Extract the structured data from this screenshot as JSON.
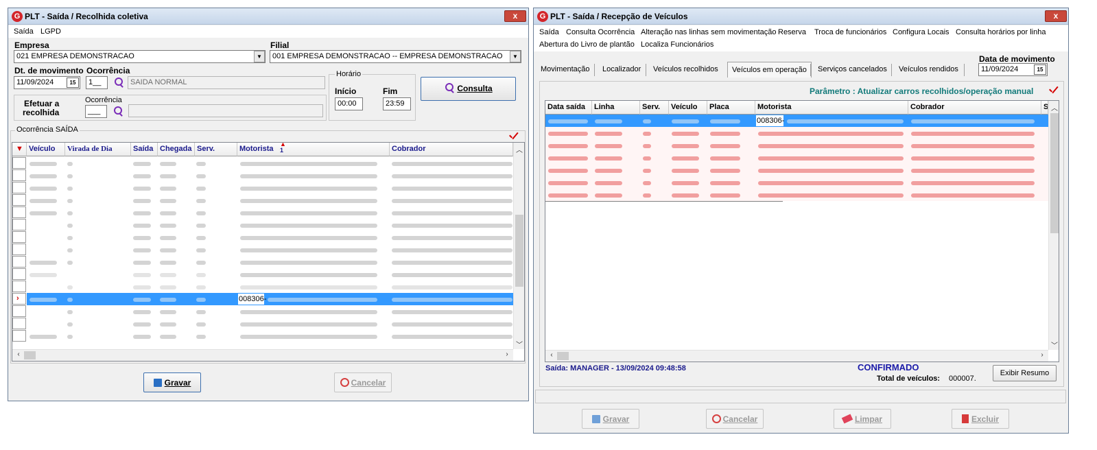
{
  "left_window": {
    "title": "PLT - Saída / Recolhida coletiva",
    "close_label": "x",
    "menu": [
      "Saída",
      "LGPD"
    ],
    "empresa_label": "Empresa",
    "empresa_value": "021 EMPRESA DEMONSTRACAO",
    "filial_label": "Filial",
    "filial_value": "001 EMPRESA DEMONSTRACAO -- EMPRESA DEMONSTRACAO",
    "dt_movimento_label": "Dt. de movimento",
    "dt_movimento_value": "11/09/2024",
    "calendar_label": "15",
    "ocorrencia_label": "Ocorrência",
    "ocorrencia_code": "1__",
    "ocorrencia_desc": "SAIDA NORMAL",
    "efetuar_label_1": "Efetuar a",
    "efetuar_label_2": "recolhida",
    "ocorrencia2_label": "Ocorrência",
    "ocorrencia2_code": "___",
    "horario_label": "Horário",
    "inicio_label": "Início",
    "inicio_value": "00:00",
    "fim_label": "Fim",
    "fim_value": "23:59",
    "consulta_button": "Consulta",
    "group_label": "Ocorrência SAÍDA",
    "columns": [
      "Veículo",
      "Virada de Dia",
      "Saída",
      "Chegada",
      "Serv.",
      "Motorista",
      "Cobrador"
    ],
    "sort_indicator": "1",
    "selected_motorista_prefix": "008306-",
    "gravar_button": "Gravar",
    "cancelar_button": "Cancelar"
  },
  "right_window": {
    "title": "PLT - Saída / Recepção de Veículos",
    "close_label": "x",
    "menu_row1": [
      "Saída",
      "Consulta Ocorrência",
      "Alteração nas linhas sem movimentação",
      "Reserva",
      "Troca de funcionários",
      "Configura Locais",
      "Consulta horários por linha"
    ],
    "menu_row2": [
      "Abertura do Livro de plantão",
      "Localiza Funcionários"
    ],
    "data_movimento_label": "Data de movimento",
    "data_movimento_value": "11/09/2024",
    "calendar_label": "15",
    "tabs": [
      "Movimentação",
      "Localizador",
      "Veículos recolhidos",
      "Veículos em operação",
      "Serviços cancelados",
      "Veículos rendidos"
    ],
    "active_tab_index": 3,
    "parametro_text": "Parâmetro : Atualizar carros recolhidos/operação manual",
    "columns": [
      "Data saída",
      "Linha",
      "Serv.",
      "Veículo",
      "Placa",
      "Motorista",
      "Cobrador",
      "S"
    ],
    "selected_motorista_prefix": "008306-",
    "saida_status": "Saída: MANAGER - 13/09/2024 09:48:58",
    "confirmado": "CONFIRMADO",
    "total_label": "Total de veículos:",
    "total_value": "000007.",
    "exibir_resumo": "Exibir Resumo",
    "gravar_button": "Gravar",
    "cancelar_button": "Cancelar",
    "limpar_button": "Limpar",
    "excluir_button": "Excluir"
  },
  "colors": {
    "selection": "#3399ff",
    "blurred_red": "#f4a0a0",
    "parametro_text": "#127a7a",
    "confirmado": "#1a1aa8"
  }
}
